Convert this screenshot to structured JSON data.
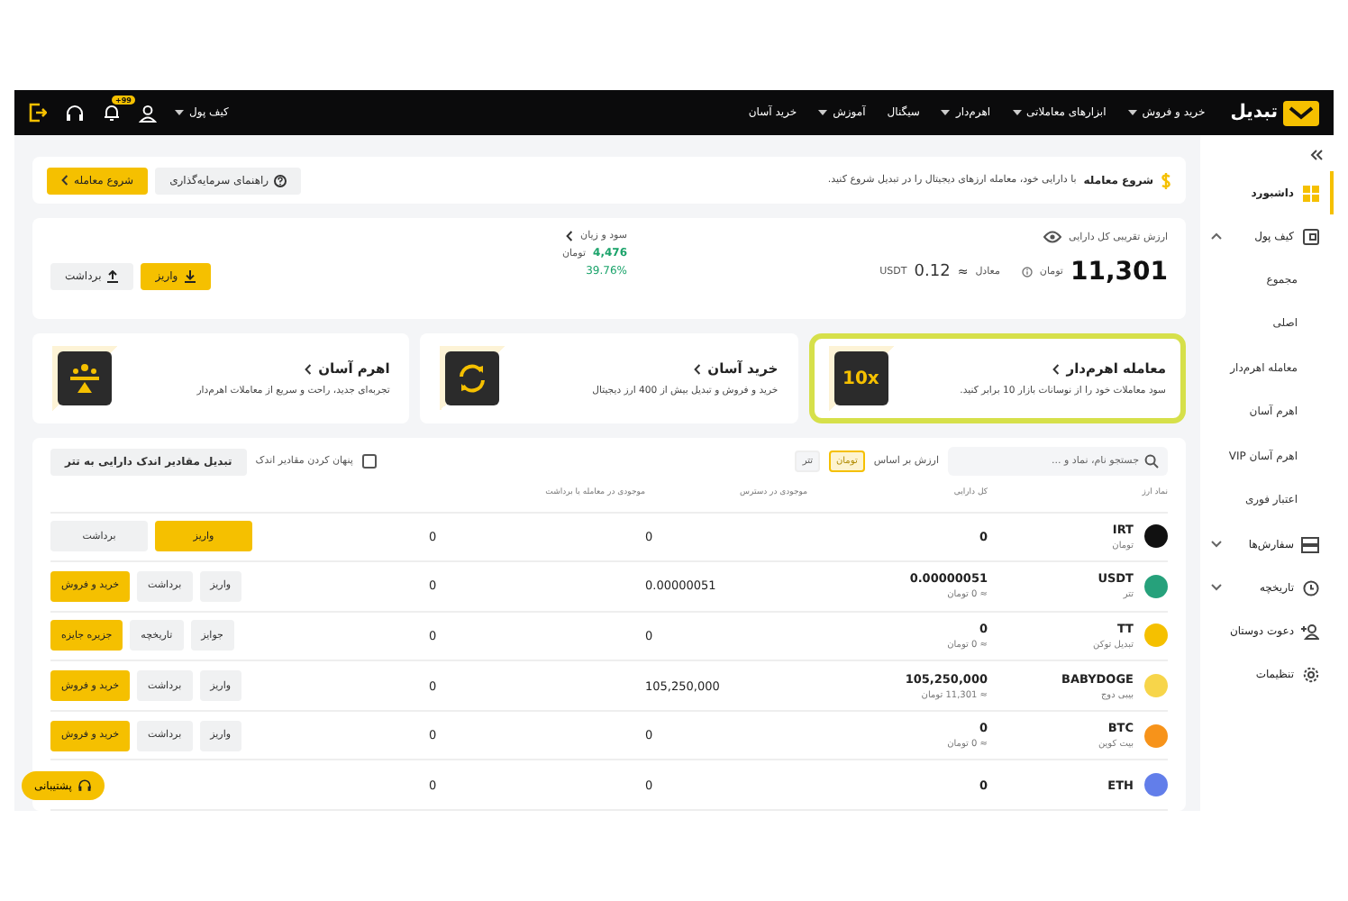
{
  "header": {
    "logo": "تبدیل",
    "nav": [
      {
        "label": "خرید و فروش",
        "dropdown": true
      },
      {
        "label": "ابزارهای معاملاتی",
        "dropdown": true
      },
      {
        "label": "اهرم‌دار",
        "dropdown": true
      },
      {
        "label": "سیگنال",
        "dropdown": false
      },
      {
        "label": "آموزش",
        "dropdown": true
      },
      {
        "label": "خرید آسان",
        "dropdown": false
      }
    ],
    "wallet": "کیف پول",
    "notification_count": "99+"
  },
  "sidebar": {
    "items": [
      {
        "label": "داشبورد",
        "selected": true
      },
      {
        "label": "کیف پول",
        "selected": false,
        "expanded": true,
        "children": [
          {
            "label": "مجموع",
            "selected": false
          },
          {
            "label": "اصلی",
            "selected": false
          },
          {
            "label": "معامله اهرم‌دار",
            "selected": false
          },
          {
            "label": "اهرم آسان",
            "selected": false
          },
          {
            "label": "اهرم آسان VIP",
            "selected": false
          },
          {
            "label": "اعتبار فوری",
            "selected": false
          }
        ]
      },
      {
        "label": "سفارش‌ها",
        "selected": false,
        "expanded": false
      },
      {
        "label": "تاریخچه",
        "selected": false,
        "expanded": false
      },
      {
        "label": "دعوت دوستان",
        "selected": false
      },
      {
        "label": "تنظیمات",
        "selected": false
      }
    ]
  },
  "banner": {
    "title": "شروع معامله",
    "text": "با دارایی خود، معامله ارزهای دیجیتال را در تبدیل شروع کنید.",
    "guide_button": "راهنمای سرمایه‌گذاری",
    "start_button": "شروع معامله"
  },
  "balance": {
    "label": "ارزش تقریبی کل دارایی",
    "value": "11,301",
    "currency": "تومان",
    "equivalent_label": "معادل",
    "approx": "≈",
    "equivalent_value": "0.12",
    "equivalent_currency": "USDT",
    "profit_label": "سود و زیان",
    "profit_value": "4,476",
    "profit_currency": "تومان",
    "profit_percent": "39.76%",
    "deposit_button": "واریز",
    "withdraw_button": "برداشت"
  },
  "promos": [
    {
      "title": "معامله اهرم‌دار",
      "text": "سود معاملات خود را از نوسانات بازار 10 برابر کنید.",
      "badge": "10x",
      "highlighted": true
    },
    {
      "title": "خرید آسان",
      "text": "خرید و فروش و تبدیل بیش از 400 ارز دیجیتال",
      "highlighted": false
    },
    {
      "title": "اهرم آسان",
      "text": "تجربه‌ای جدید، راحت و سریع از معاملات اهرم‌دار",
      "highlighted": false
    }
  ],
  "assets": {
    "search_placeholder": "جستجو نام، نماد و ...",
    "value_basis_label": "ارزش بر اساس",
    "value_basis": [
      {
        "label": "تومان",
        "selected": true
      },
      {
        "label": "تتر",
        "selected": false
      }
    ],
    "hide_small": {
      "label": "پنهان کردن مقادیر اندک",
      "checked": false
    },
    "convert_button": "تبدیل مقادیر اندک دارایی به تتر",
    "columns": [
      "نماد ارز",
      "کل دارایی",
      "موجودی در دسترس",
      "موجودی در معامله یا برداشت"
    ],
    "rows": [
      {
        "symbol": "IRT",
        "name": "تومان",
        "color": "#111111",
        "total": "0",
        "available": "0",
        "in_trade": "0",
        "buttons": [
          {
            "label": "واریز",
            "primary": true
          },
          {
            "label": "برداشت",
            "primary": false
          }
        ]
      },
      {
        "symbol": "USDT",
        "name": "تتر",
        "color": "#26a17b",
        "total": "0.00000051",
        "total_toman": "≈ 0 تومان",
        "available": "0.00000051",
        "in_trade": "0",
        "buttons": [
          {
            "label": "واریز",
            "primary": false
          },
          {
            "label": "برداشت",
            "primary": false
          },
          {
            "label": "خرید و فروش",
            "primary": true
          }
        ]
      },
      {
        "symbol": "TT",
        "name": "تبدیل توکن",
        "color": "#f5c000",
        "total": "0",
        "total_toman": "≈ 0 تومان",
        "available": "0",
        "in_trade": "0",
        "buttons": [
          {
            "label": "جوایز",
            "primary": false
          },
          {
            "label": "تاریخچه",
            "primary": false
          },
          {
            "label": "جزیره جایزه",
            "primary": true
          }
        ]
      },
      {
        "symbol": "BABYDOGE",
        "name": "بیبی دوج",
        "color": "#f7d54a",
        "total": "105,250,000",
        "total_toman": "≈ 11,301 تومان",
        "available": "105,250,000",
        "in_trade": "0",
        "buttons": [
          {
            "label": "واریز",
            "primary": false
          },
          {
            "label": "برداشت",
            "primary": false
          },
          {
            "label": "خرید و فروش",
            "primary": true
          }
        ]
      },
      {
        "symbol": "BTC",
        "name": "بیت کوین",
        "color": "#f7931a",
        "total": "0",
        "total_toman": "≈ 0 تومان",
        "available": "0",
        "in_trade": "0",
        "buttons": [
          {
            "label": "واریز",
            "primary": false
          },
          {
            "label": "برداشت",
            "primary": false
          },
          {
            "label": "خرید و فروش",
            "primary": true
          }
        ]
      },
      {
        "symbol": "ETH",
        "color": "#627eea",
        "total": "0",
        "available": "0",
        "in_trade": "0"
      }
    ]
  },
  "support_button": "پشتیبانی"
}
